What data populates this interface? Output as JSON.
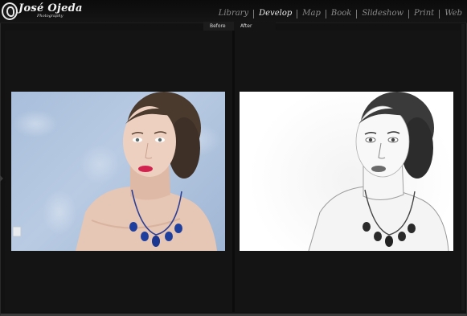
{
  "brand": {
    "name": "José Ojeda",
    "subtitle": "Photography"
  },
  "nav": {
    "items": [
      {
        "label": "Library",
        "active": false
      },
      {
        "label": "Develop",
        "active": true
      },
      {
        "label": "Map",
        "active": false
      },
      {
        "label": "Book",
        "active": false
      },
      {
        "label": "Slideshow",
        "active": false
      },
      {
        "label": "Print",
        "active": false
      },
      {
        "label": "Web",
        "active": false
      }
    ]
  },
  "compare": {
    "before_label": "Before",
    "after_label": "After"
  },
  "colors": {
    "background": "#111111",
    "nav_active": "#ededed",
    "nav_inactive": "#8a8a8a",
    "lips": "#d1234e",
    "necklace": "#1f3f9e"
  }
}
